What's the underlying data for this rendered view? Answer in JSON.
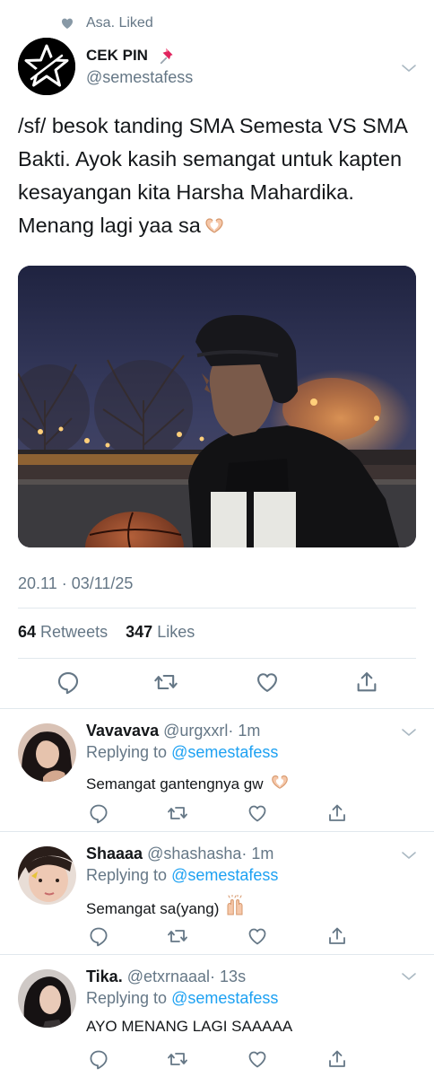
{
  "social_context": {
    "text": "Asa. Liked"
  },
  "tweet": {
    "author_name": "CEK PIN",
    "author_handle": "@semestafess",
    "text": "/sf/ besok tanding SMA Semesta VS SMA Bakti. Ayok kasih semangat untuk kapten kesayangan kita Harsha Mahardika. Menang lagi yaa sa",
    "timestamp": "20.11 · 03/11/25",
    "retweets_count": "64",
    "retweets_label": "Retweets",
    "likes_count": "347",
    "likes_label": "Likes"
  },
  "replies": [
    {
      "name": "Vavavava",
      "handle": "@urgxxrl",
      "time": "· 1m",
      "replying_prefix": "Replying to ",
      "replying_to": "@semestafess",
      "text": "Semangat gantengnya gw"
    },
    {
      "name": "Shaaaa",
      "handle": "@shashasha",
      "time": "· 1m",
      "replying_prefix": "Replying to ",
      "replying_to": "@semestafess",
      "text": "Semangat sa(yang)"
    },
    {
      "name": "Tika.",
      "handle": "@etxrnaaal",
      "time": "· 13s",
      "replying_prefix": "Replying to ",
      "replying_to": "@semestafess",
      "text": "AYO MENANG LAGI SAAAAA"
    }
  ],
  "colors": {
    "link": "#1da1f2",
    "secondary_text": "#657786",
    "divider": "#e1e8ed",
    "primary_text": "#14171a"
  },
  "icons": [
    "heart-icon",
    "pushpin-icon",
    "chevron-down-icon",
    "reply-icon",
    "retweet-icon",
    "like-icon",
    "share-icon",
    "heart-hands-emoji",
    "raising-hands-emoji"
  ]
}
